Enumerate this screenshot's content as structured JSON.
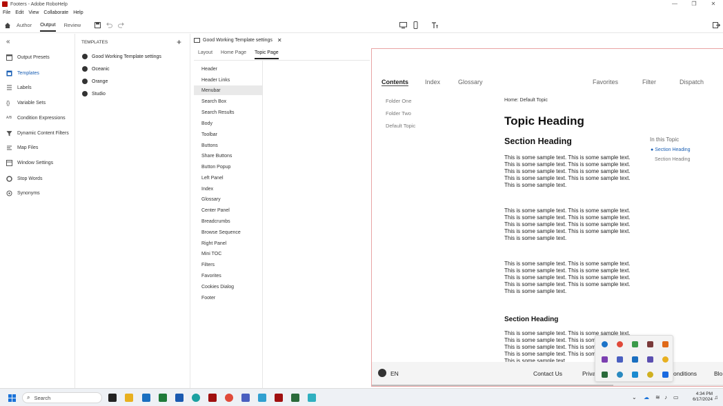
{
  "window": {
    "title": "Footers - Adobe RoboHelp",
    "controls": [
      "—",
      "❐",
      "✕"
    ]
  },
  "menubar": [
    "File",
    "Edit",
    "View",
    "Collaborate",
    "Help"
  ],
  "toolbar": {
    "tabs": [
      "Author",
      "Output",
      "Review"
    ],
    "active_tab": "Output"
  },
  "leftnav": {
    "items": [
      {
        "label": "Output Presets",
        "icon": "output-presets-icon"
      },
      {
        "label": "Templates",
        "icon": "templates-icon",
        "active": true
      },
      {
        "label": "Labels",
        "icon": "labels-icon"
      },
      {
        "label": "Variable Sets",
        "icon": "variable-sets-icon"
      },
      {
        "label": "Condition Expressions",
        "icon": "condition-expressions-icon"
      },
      {
        "label": "Dynamic Content Filters",
        "icon": "filter-icon"
      },
      {
        "label": "Map Files",
        "icon": "map-files-icon"
      },
      {
        "label": "Window Settings",
        "icon": "window-settings-icon"
      },
      {
        "label": "Stop Words",
        "icon": "stop-words-icon"
      },
      {
        "label": "Synonyms",
        "icon": "synonyms-icon"
      }
    ]
  },
  "templates": {
    "header": "TEMPLATES",
    "items": [
      "Good Working Template settings",
      "Oceanic",
      "Orange",
      "Studio"
    ]
  },
  "settings": {
    "tab_title": "Good Working Template settings",
    "subtabs": [
      "Layout",
      "Home Page",
      "Topic Page"
    ],
    "active_subtab": "Topic Page",
    "items": [
      "Header",
      "Header Links",
      "Menubar",
      "Search Box",
      "Search Results",
      "Body",
      "Toolbar",
      "Buttons",
      "Share Buttons",
      "Button Popup",
      "Left Panel",
      "Index",
      "Glossary",
      "Center Panel",
      "Breadcrumbs",
      "Browse Sequence",
      "Right Panel",
      "Mini TOC",
      "Filters",
      "Favorites",
      "Cookies Dialog",
      "Footer"
    ],
    "active_item": "Menubar"
  },
  "preview": {
    "left_tabs": [
      "Contents",
      "Index",
      "Glossary"
    ],
    "right_tabs": [
      "Favorites",
      "Filter",
      "Dispatch"
    ],
    "toc": [
      "Folder One",
      "Folder Two",
      "Default Topic"
    ],
    "breadcrumb": "Home: Default Topic",
    "topic_heading": "Topic Heading",
    "section_heading": "Section Heading",
    "paragraph": "This is some sample text. This is some sample text. This is some sample text. This is some sample text. This is some sample text. This is some sample text. This is some sample text. This is some sample text. This is some sample text.",
    "section_heading_small": "Section Heading",
    "mini_toc_title": "In this Topic",
    "mini_toc_items": [
      "Section Heading",
      "Section Heading"
    ],
    "footer": {
      "lang": "EN",
      "links": [
        "Contact Us",
        "Priva",
        "onditions",
        "Blo"
      ]
    }
  },
  "taskbar": {
    "search_placeholder": "Search",
    "time": "4:34 PM",
    "date": "6/17/2024"
  }
}
